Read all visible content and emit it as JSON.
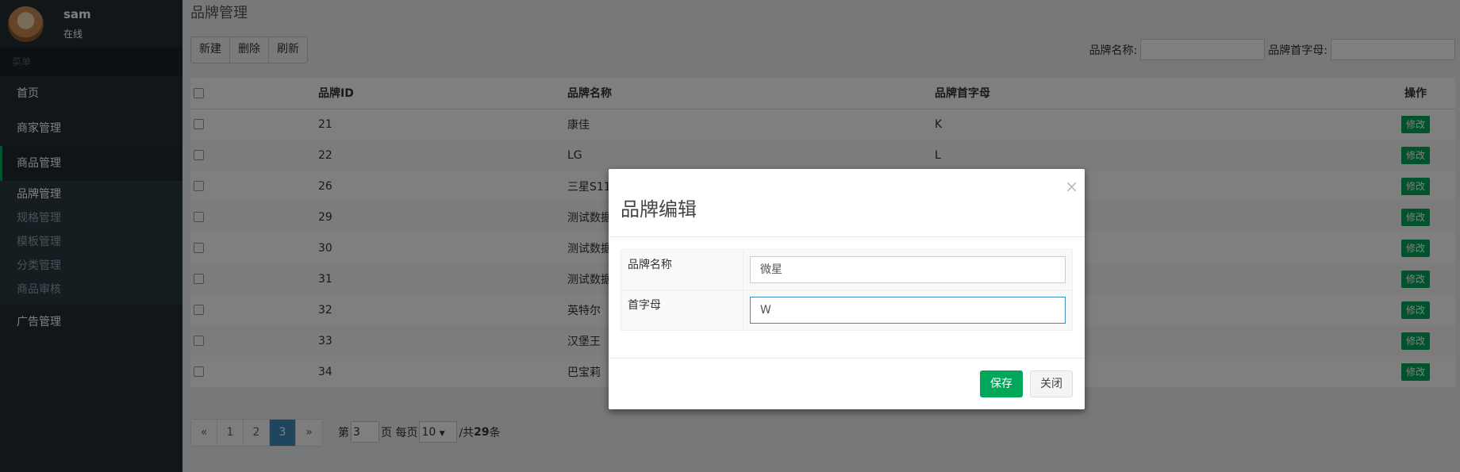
{
  "user": {
    "name": "sam",
    "status": "在线"
  },
  "sidebar": {
    "header": "菜单",
    "items": [
      {
        "label": "首页"
      },
      {
        "label": "商家管理"
      },
      {
        "label": "商品管理"
      },
      {
        "label": "广告管理"
      }
    ],
    "subitems": [
      {
        "label": "品牌管理"
      },
      {
        "label": "规格管理"
      },
      {
        "label": "模板管理"
      },
      {
        "label": "分类管理"
      },
      {
        "label": "商品审核"
      }
    ]
  },
  "main": {
    "title": "品牌管理",
    "toolbar": {
      "new_label": "新建",
      "delete_label": "删除",
      "refresh_label": "刷新"
    },
    "search": {
      "name_label": "品牌名称:",
      "first_letter_label": "品牌首字母:"
    },
    "table": {
      "headers": {
        "id": "品牌ID",
        "name": "品牌名称",
        "first_char": "品牌首字母",
        "actions": "操作"
      },
      "edit_label": "修改",
      "rows": [
        {
          "id": "21",
          "name": "康佳",
          "first_char": "K"
        },
        {
          "id": "22",
          "name": "LG",
          "first_char": "L"
        },
        {
          "id": "26",
          "name": "三星S11",
          "first_char": ""
        },
        {
          "id": "29",
          "name": "测试数据",
          "first_char": ""
        },
        {
          "id": "30",
          "name": "测试数据",
          "first_char": ""
        },
        {
          "id": "31",
          "name": "测试数据",
          "first_char": ""
        },
        {
          "id": "32",
          "name": "英特尔",
          "first_char": ""
        },
        {
          "id": "33",
          "name": "汉堡王",
          "first_char": ""
        },
        {
          "id": "34",
          "name": "巴宝莉",
          "first_char": ""
        }
      ]
    },
    "pagination": {
      "prev": "«",
      "pages": [
        "1",
        "2",
        "3"
      ],
      "next": "»",
      "current": "3",
      "page_prefix": "第",
      "page_value": "3",
      "page_suffix": "页 每页",
      "per_page": "10",
      "total_prefix": "/共",
      "total": "29",
      "total_suffix": "条"
    }
  },
  "modal": {
    "title": "品牌编辑",
    "close_glyph": "×",
    "name_label": "品牌名称",
    "name_value": "微星",
    "letter_label": "首字母",
    "letter_value": "W",
    "save_label": "保存",
    "close_label": "关闭"
  },
  "colors": {
    "accent": "#00a65a",
    "sidebar": "#222d32",
    "active_page": "#3c8dbc"
  }
}
